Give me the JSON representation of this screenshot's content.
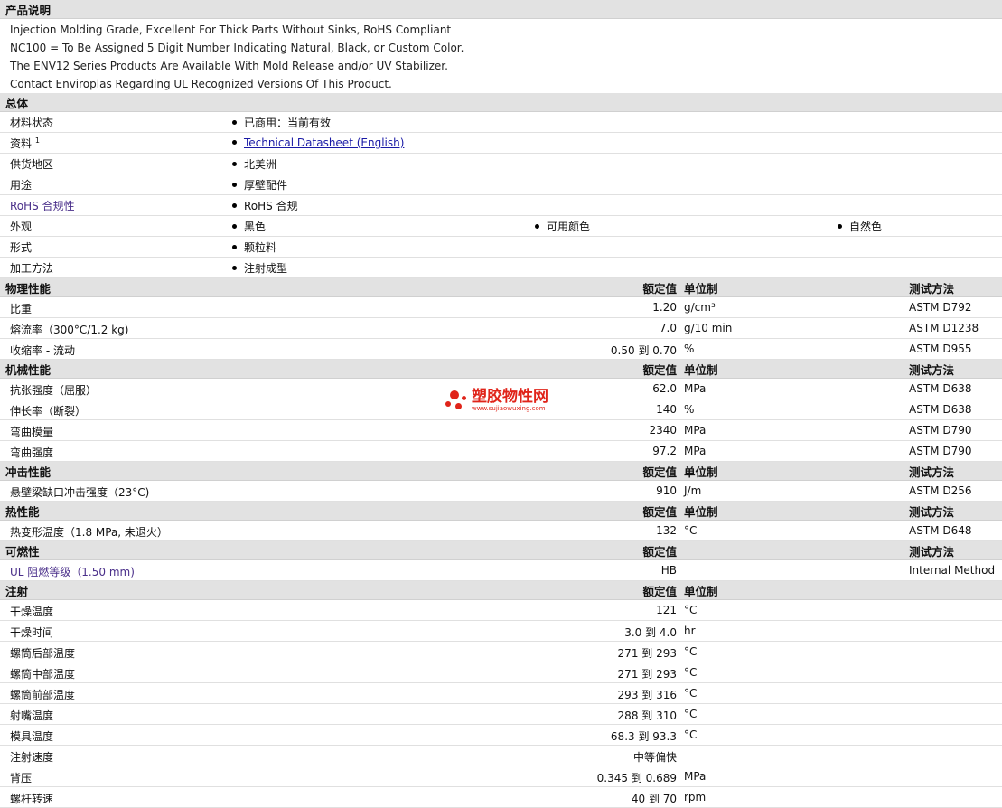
{
  "description": {
    "title": "产品说明",
    "lines": [
      "Injection Molding Grade, Excellent For Thick Parts Without Sinks, RoHS Compliant",
      "NC100 = To Be Assigned 5 Digit Number Indicating Natural, Black, or Custom Color.",
      "The ENV12 Series Products Are Available With Mold Release and/or UV Stabilizer.",
      "Contact Enviroplas Regarding UL Recognized Versions Of This Product."
    ]
  },
  "general": {
    "title": "总体",
    "rows": [
      {
        "label": "材料状态",
        "value": "已商用：当前有效"
      },
      {
        "label": "资料",
        "sup": "1",
        "value": "Technical Datasheet (English)"
      },
      {
        "label": "供货地区",
        "value": "北美洲"
      },
      {
        "label": "用途",
        "value": "厚壁配件"
      },
      {
        "label": "RoHS 合规性",
        "value": "RoHS 合规"
      },
      {
        "label": "外观",
        "value": "黑色",
        "value2": "可用颜色",
        "value3": "自然色"
      },
      {
        "label": "形式",
        "value": "颗粒料"
      },
      {
        "label": "加工方法",
        "value": "注射成型"
      }
    ]
  },
  "headers": {
    "rated": "额定值",
    "unit": "单位制",
    "test": "测试方法"
  },
  "physical": {
    "title": "物理性能",
    "rows": [
      {
        "label": "比重",
        "value": "1.20",
        "unit": "g/cm³",
        "test": "ASTM D792"
      },
      {
        "label": "熔流率（300°C/1.2 kg)",
        "value": "7.0",
        "unit": "g/10 min",
        "test": "ASTM D1238"
      },
      {
        "label": "收缩率 - 流动",
        "value": "0.50 到  0.70",
        "unit": "%",
        "test": "ASTM D955"
      }
    ]
  },
  "mechanical": {
    "title": "机械性能",
    "rows": [
      {
        "label": "抗张强度（屈服）",
        "value": "62.0",
        "unit": "MPa",
        "test": "ASTM D638"
      },
      {
        "label": "伸长率（断裂）",
        "value": "140",
        "unit": "%",
        "test": "ASTM D638"
      },
      {
        "label": "弯曲模量",
        "value": "2340",
        "unit": "MPa",
        "test": "ASTM D790"
      },
      {
        "label": "弯曲强度",
        "value": "97.2",
        "unit": "MPa",
        "test": "ASTM D790"
      }
    ]
  },
  "impact": {
    "title": "冲击性能",
    "rows": [
      {
        "label": "悬壁梁缺口冲击强度（23°C)",
        "value": "910",
        "unit": "J/m",
        "test": "ASTM D256"
      }
    ]
  },
  "thermal": {
    "title": "热性能",
    "rows": [
      {
        "label": "热变形温度（1.8 MPa, 未退火）",
        "value": "132",
        "unit": "°C",
        "test": "ASTM D648"
      }
    ]
  },
  "flammability": {
    "title": "可燃性",
    "rows": [
      {
        "label": "UL 阻燃等级（1.50 mm)",
        "value": "HB",
        "unit": "",
        "test": "Internal Method"
      }
    ]
  },
  "injection": {
    "title": "注射",
    "rows": [
      {
        "label": "干燥温度",
        "value": "121",
        "unit": "°C"
      },
      {
        "label": "干燥时间",
        "value": "3.0 到  4.0",
        "unit": "hr"
      },
      {
        "label": "螺筒后部温度",
        "value": "271 到  293",
        "unit": "°C"
      },
      {
        "label": "螺筒中部温度",
        "value": "271 到  293",
        "unit": "°C"
      },
      {
        "label": "螺筒前部温度",
        "value": "293 到  316",
        "unit": "°C"
      },
      {
        "label": "射嘴温度",
        "value": "288 到  310",
        "unit": "°C"
      },
      {
        "label": "模具温度",
        "value": "68.3 到  93.3",
        "unit": "°C"
      },
      {
        "label": "注射速度",
        "value": "中等偏快",
        "unit": ""
      },
      {
        "label": "背压",
        "value": "0.345 到  0.689",
        "unit": "MPa"
      },
      {
        "label": "螺杆转速",
        "value": "40 到  70",
        "unit": "rpm"
      }
    ]
  },
  "watermark": {
    "name": "塑胶物性网",
    "url": "www.sujiaowuxing.com"
  }
}
